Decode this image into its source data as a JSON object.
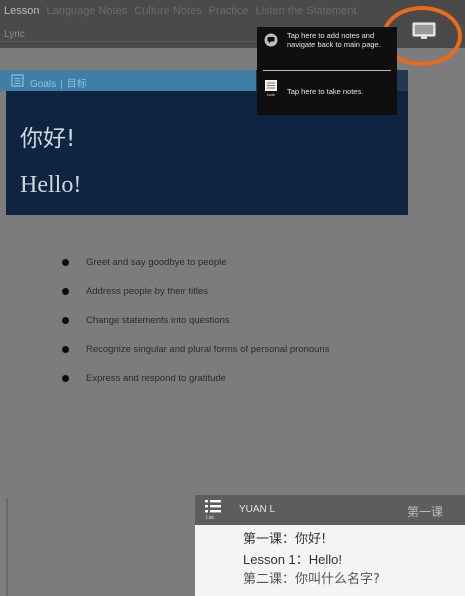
{
  "top_bar": {
    "tabs": [
      "Lesson",
      "Language Notes",
      "Culture Notes",
      "Practice",
      "Listen the Statement"
    ],
    "subtab": "Lyric"
  },
  "goals_bar": {
    "label_en": "Goals",
    "separator": "|",
    "label_zh": "目标"
  },
  "popover": {
    "notes_hint": "Tap here to add notes and navigate back to main page.",
    "take_notes_hint": "Tap here to take notes.",
    "take_notes_icon_caption": "Note"
  },
  "hero": {
    "chinese_title": "你好!",
    "english_title": "Hello!"
  },
  "goals": [
    "Greet and say goodbye to people",
    "Address people by their titles",
    "Change statements into questions",
    "Recognize singular and plural forms of personal pronouns",
    "Express and respond to gratitude"
  ],
  "lesson_panel": {
    "list_caption": "List",
    "user_name": "YUAN L",
    "header_right": "第一课",
    "lines": [
      "第一课：你好!",
      "Lesson 1：Hello!",
      "第二课：你叫什么名字?"
    ]
  },
  "colors": {
    "background": "#7c7c7c",
    "hero": "#0e2440",
    "goals_bar": "#3f7fa7",
    "highlight_ring": "#ec6a15"
  }
}
